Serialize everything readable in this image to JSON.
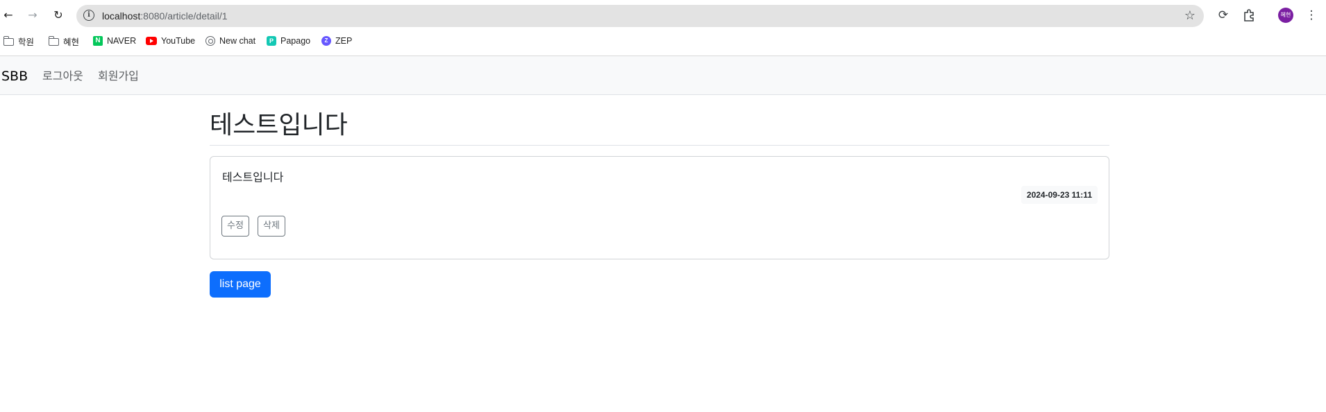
{
  "browser": {
    "url_host": "localhost",
    "url_path": ":8080/article/detail/1",
    "profile_initials": "혜현",
    "icons": {
      "back": "arrow-left-icon",
      "forward": "arrow-right-icon",
      "reload": "reload-icon",
      "site_info": "info-icon",
      "bookmark": "star-icon",
      "refresh_ext": "circular-arrow-icon",
      "extensions": "puzzle-icon",
      "menu": "kebab-menu-icon"
    }
  },
  "bookmarks": [
    {
      "label": "학원",
      "icon": "folder-icon"
    },
    {
      "label": "혜현",
      "icon": "folder-icon"
    },
    {
      "label": "NAVER",
      "icon": "naver-icon"
    },
    {
      "label": "YouTube",
      "icon": "youtube-icon"
    },
    {
      "label": "New chat",
      "icon": "chatgpt-icon"
    },
    {
      "label": "Papago",
      "icon": "papago-icon"
    },
    {
      "label": "ZEP",
      "icon": "zep-icon"
    }
  ],
  "navbar": {
    "brand": "SBB",
    "links": [
      "로그아웃",
      "회원가입"
    ]
  },
  "article": {
    "title": "테스트입니다",
    "content": "테스트입니다",
    "created_date": "2024-09-23 11:11",
    "edit_label": "수정",
    "delete_label": "삭제"
  },
  "list_button": "list page",
  "colors": {
    "primary": "#0d6efd",
    "navbar_bg": "#f8f9fa",
    "profile": "#7b1fa2"
  }
}
